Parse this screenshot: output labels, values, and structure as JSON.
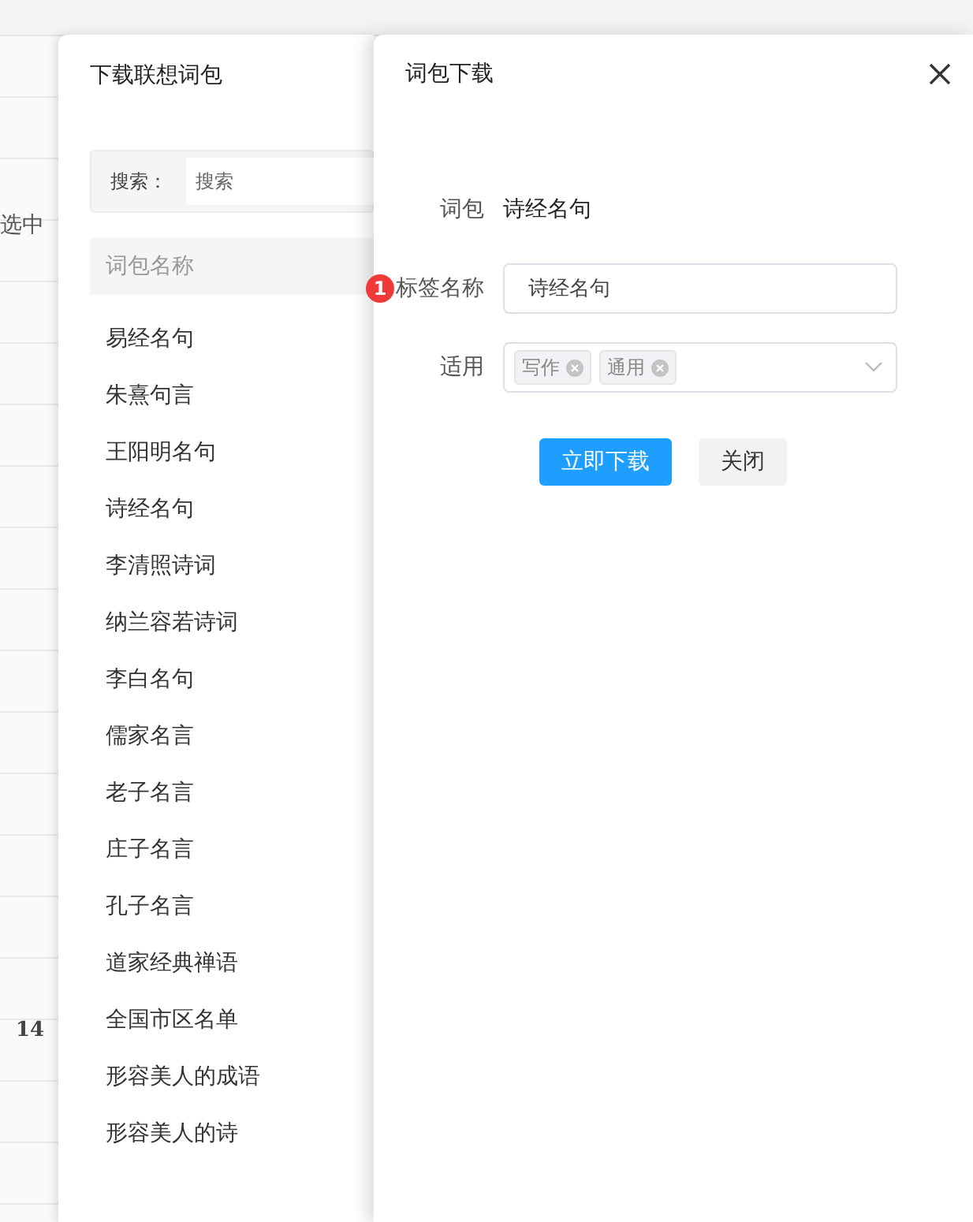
{
  "background": {
    "cut_text": "选中",
    "row_number": "14"
  },
  "list_drawer": {
    "title": "下载联想词包",
    "search": {
      "label": "搜索：",
      "placeholder": "搜索"
    },
    "column_header": "词包名称",
    "items": [
      "易经名句",
      "朱熹句言",
      "王阳明名句",
      "诗经名句",
      "李清照诗词",
      "纳兰容若诗词",
      "李白名句",
      "儒家名言",
      "老子名言",
      "庄子名言",
      "孔子名言",
      "道家经典禅语",
      "全国市区名单",
      "形容美人的成语",
      "形容美人的诗"
    ]
  },
  "download_drawer": {
    "title": "词包下载",
    "fields": [
      {
        "kind": "text",
        "label": "词包",
        "value": "诗经名句"
      },
      {
        "kind": "input",
        "label": "标签名称",
        "value": "诗经名句",
        "badge": "1"
      },
      {
        "kind": "select",
        "label": "适用",
        "tags": [
          "写作",
          "通用"
        ]
      }
    ],
    "buttons": [
      {
        "kind": "primary",
        "label": "立即下载"
      },
      {
        "kind": "default",
        "label": "关闭"
      }
    ]
  }
}
